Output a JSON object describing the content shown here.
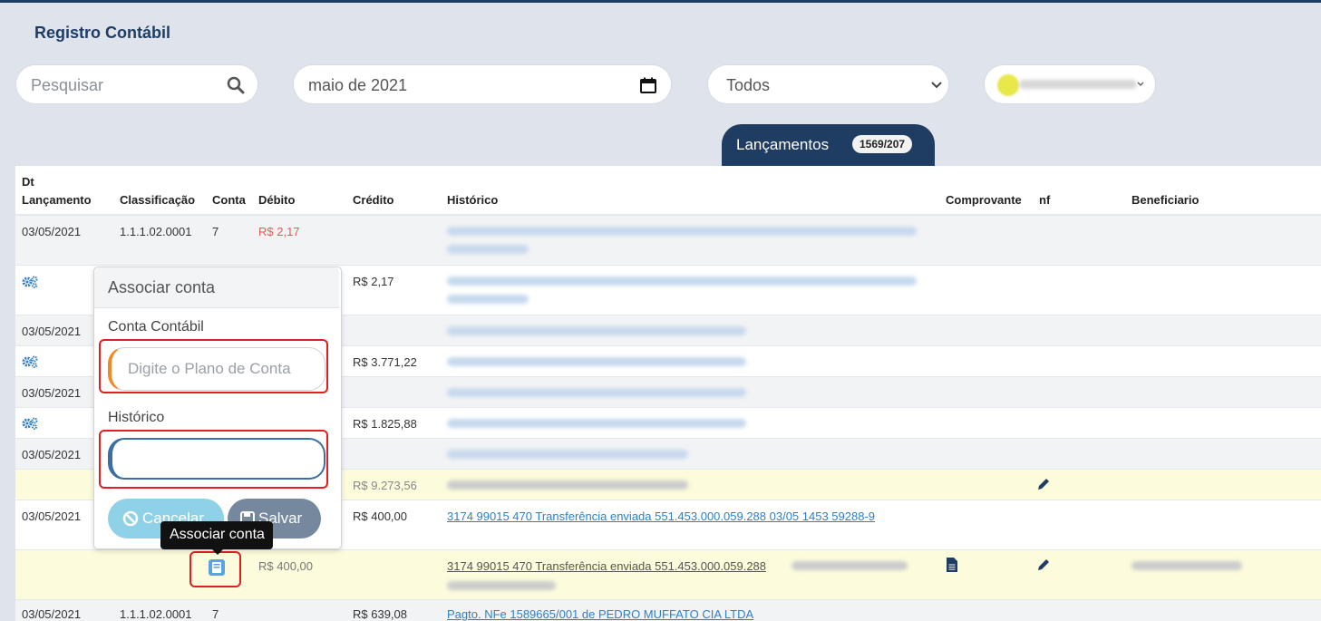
{
  "page": {
    "title": "Registro Contábil"
  },
  "filters": {
    "search_placeholder": "Pesquisar",
    "date_value": "maio de 2021",
    "select_value": "Todos"
  },
  "tab": {
    "label": "Lançamentos",
    "badge": "1569/207"
  },
  "columns": {
    "dt_line1": "Dt",
    "dt_line2": "Lançamento",
    "classificacao": "Classificação",
    "conta": "Conta",
    "debito": "Débito",
    "credito": "Crédito",
    "historico": "Histórico",
    "comprovante": "Comprovante",
    "nf": "nf",
    "beneficiario": "Beneficiario"
  },
  "rows": [
    {
      "date": "03/05/2021",
      "classificacao": "1.1.1.02.0001",
      "conta": "7",
      "debito": "R$ 2,17"
    },
    {
      "credito": "R$ 2,17"
    },
    {
      "date": "03/05/2021"
    },
    {
      "credito": "R$ 3.771,22"
    },
    {
      "date": "03/05/2021"
    },
    {
      "credito": "R$ 1.825,88"
    },
    {
      "date": "03/05/2021"
    },
    {
      "credito": "R$ 9.273,56"
    },
    {
      "date": "03/05/2021",
      "credito": "R$ 400,00",
      "historico": "3174 99015 470 Transferência enviada 551.453.000.059.288 03/05 1453 59288-9"
    },
    {
      "debito": "R$ 400,00",
      "historico": "3174 99015 470 Transferência enviada 551.453.000.059.288"
    },
    {
      "date": "03/05/2021",
      "classificacao": "1.1.1.02.0001",
      "conta": "7",
      "credito": "R$ 639,08",
      "historico": "Pagto. NFe 1589665/001 de PEDRO MUFFATO CIA LTDA"
    }
  ],
  "popover": {
    "title": "Associar conta",
    "conta_label": "Conta Contábil",
    "conta_placeholder": "Digite o Plano de Conta",
    "historico_label": "Histórico",
    "cancel_label": "Cancelar",
    "save_label": "Salvar"
  },
  "tooltip": {
    "text": "Associar conta"
  },
  "colors": {
    "navy": "#1f3d63",
    "link": "#2f7fc8",
    "debit": "#e25b5b",
    "highlight": "#e02020"
  }
}
